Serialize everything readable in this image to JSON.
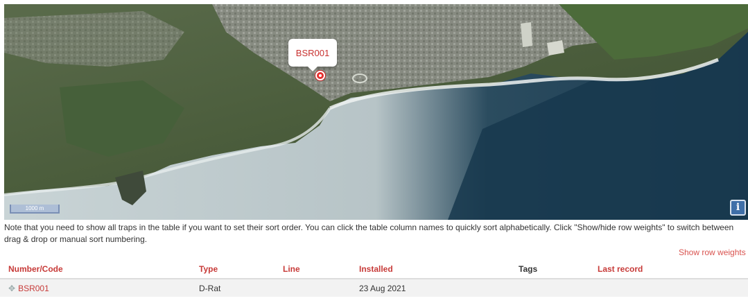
{
  "map": {
    "marker_label": "BSR001",
    "scale_label": "1000 m",
    "info_label": "i"
  },
  "note": "Note that you need to show all traps in the table if you want to set their sort order. You can click the table column names to quickly sort alphabetically. Click \"Show/hide row weights\" to switch between drag & drop or manual sort numbering.",
  "show_row_weights": "Show row weights",
  "table": {
    "headers": [
      "Number/Code",
      "Type",
      "Line",
      "Installed",
      "Tags",
      "Last record"
    ],
    "rows": [
      {
        "code": "BSR001",
        "type": "D-Rat",
        "line": "",
        "installed": "23 Aug 2021",
        "tags": "",
        "last_record": ""
      }
    ]
  },
  "icons": {
    "drag": "drag-handle-icon",
    "marker": "trap-marker-icon",
    "info": "info-icon"
  }
}
